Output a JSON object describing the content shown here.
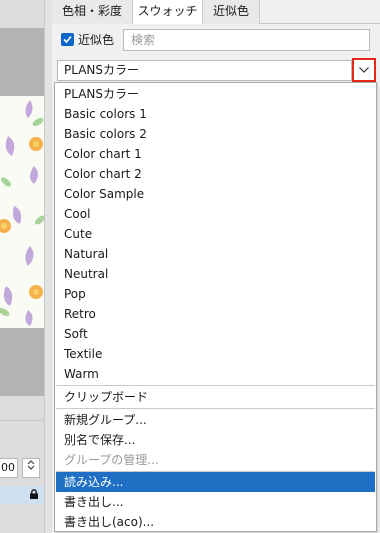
{
  "tabs": [
    "色相・彩度",
    "スウォッチ",
    "近似色"
  ],
  "approx_checkbox": {
    "label": "近似色",
    "checked": true
  },
  "search": {
    "placeholder": "検索",
    "value": ""
  },
  "dropdown": {
    "selected": "PLANSカラー"
  },
  "menu": {
    "swatch_sets": [
      "PLANSカラー",
      "Basic colors 1",
      "Basic colors 2",
      "Color chart 1",
      "Color chart 2",
      "Color Sample",
      "Cool",
      "Cute",
      "Natural",
      "Neutral",
      "Pop",
      "Retro",
      "Soft",
      "Textile",
      "Warm"
    ],
    "clipboard": "クリップボード",
    "actions": {
      "new_group": "新規グループ...",
      "save_as": "別名で保存...",
      "manage_groups": "グループの管理...",
      "import": "読み込み...",
      "export": "書き出し...",
      "export_aco": "書き出し(aco)..."
    }
  },
  "left": {
    "zoom_value": "00"
  },
  "colors": {
    "accent": "#1f6fc5",
    "highlight_border": "#e8261a",
    "checkbox": "#0a66c9"
  }
}
